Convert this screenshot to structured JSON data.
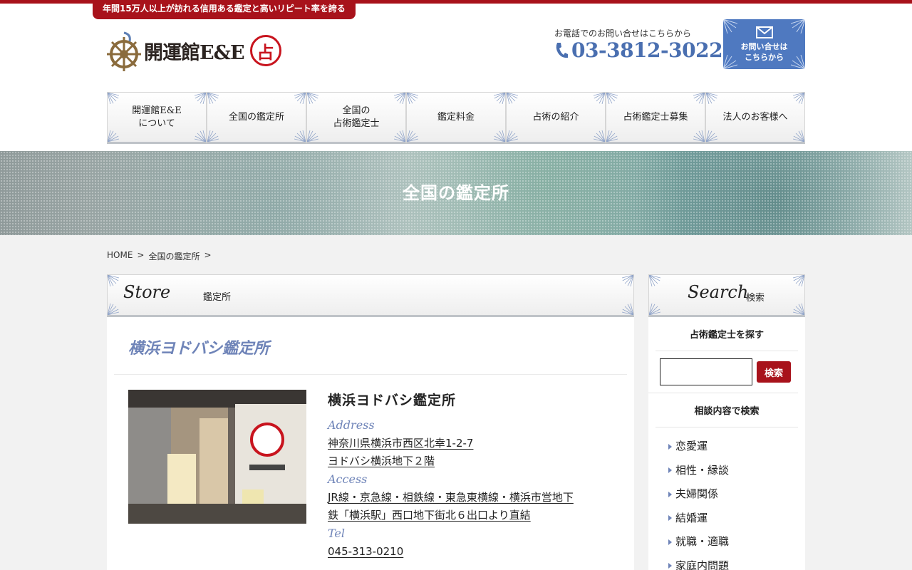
{
  "tagline": "年間15万人以上が訪れる信用ある鑑定と高いリピート率を誇る",
  "logo": {
    "text": "開運館E&E",
    "stamp": "占"
  },
  "contact": {
    "phone_caption": "お電話でのお問い合せはこちらから",
    "phone_number": "03-3812-3022",
    "button_line1": "お問い合せは",
    "button_line2": "こちらから"
  },
  "nav": [
    {
      "label": "開運館E&E\nについて"
    },
    {
      "label": "全国の鑑定所"
    },
    {
      "label": "全国の\n占術鑑定士"
    },
    {
      "label": "鑑定料金"
    },
    {
      "label": "占術の紹介"
    },
    {
      "label": "占術鑑定士募集"
    },
    {
      "label": "法人のお客様へ"
    }
  ],
  "hero_title": "全国の鑑定所",
  "breadcrumb": {
    "home": "HOME",
    "current": "全国の鑑定所",
    "sep": ">"
  },
  "main": {
    "head_script": "Store",
    "head_sub": "鑑定所",
    "store_title": "横浜ヨドバシ鑑定所",
    "store_name": "横浜ヨドバシ鑑定所",
    "address_label": "Address",
    "address_line1": "神奈川県横浜市西区北幸1-2-7",
    "address_line2": "ヨドバシ横浜地下２階",
    "access_label": "Access",
    "access_line1": "JR線・京急線・相鉄線・東急東横線・横浜市営地下",
    "access_line2": "鉄「横浜駅」西口地下街北６出口より直結",
    "tel_label": "Tel",
    "tel": "045-313-0210"
  },
  "side": {
    "head_script": "Search",
    "head_sub": "検索",
    "find_heading": "占術鑑定士を探す",
    "search_button": "検索",
    "search_value": "",
    "category_heading": "相談内容で検索",
    "categories": [
      "恋愛運",
      "相性・縁談",
      "夫婦関係",
      "結婚運",
      "就職・適職",
      "家庭内問題"
    ]
  },
  "colors": {
    "brand_red": "#a8121b",
    "accent_blue": "#4f79c0",
    "label_blue": "#6f84b8"
  }
}
